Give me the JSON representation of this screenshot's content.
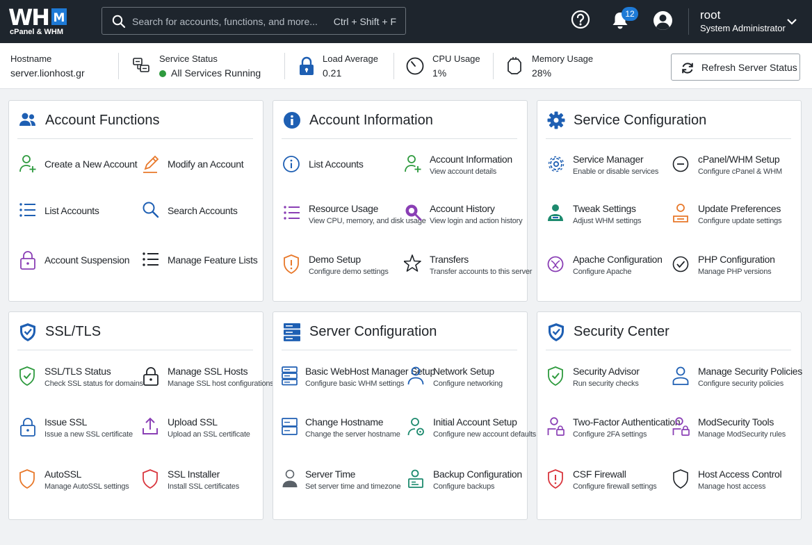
{
  "topbar": {
    "logo_text": "WH",
    "logo_m": "M",
    "logo_sub": "cPanel & WHM",
    "search_placeholder": "Search for accounts, functions, and more...",
    "search_shortcut": "Ctrl + Shift + F",
    "notification_count": "12",
    "user_name": "root",
    "user_role": "System Administrator"
  },
  "status": {
    "hostname_label": "Hostname",
    "hostname_value": "server.lionhost.gr",
    "service_label": "Service Status",
    "service_value": "All Services Running",
    "load_label": "Load Average",
    "load_value": "0.21",
    "cpu_label": "CPU Usage",
    "cpu_value": "1%",
    "memory_label": "Memory Usage",
    "memory_value": "28%",
    "refresh_label": "Refresh Server Status"
  },
  "cards": {
    "account_functions": {
      "title": "Account Functions",
      "items": [
        {
          "title": "Create a New Account"
        },
        {
          "title": "Modify an Account"
        },
        {
          "title": "List Accounts"
        },
        {
          "title": "Search Accounts"
        },
        {
          "title": "Account Suspension"
        },
        {
          "title": "Manage Feature Lists"
        }
      ]
    },
    "account_information": {
      "title": "Account Information",
      "items": [
        {
          "title": "List Accounts",
          "desc": ""
        },
        {
          "title": "Account Information",
          "desc": "View account details"
        },
        {
          "title": "Resource Usage",
          "desc": "View CPU, memory, and disk usage"
        },
        {
          "title": "Account History",
          "desc": "View login and action history"
        },
        {
          "title": "Demo Setup",
          "desc": "Configure demo settings"
        },
        {
          "title": "Transfers",
          "desc": "Transfer accounts to this server"
        }
      ]
    },
    "service_configuration": {
      "title": "Service Configuration",
      "items": [
        {
          "title": "Service Manager",
          "desc": "Enable or disable services"
        },
        {
          "title": "cPanel/WHM Setup",
          "desc": "Configure cPanel & WHM"
        },
        {
          "title": "Tweak Settings",
          "desc": "Adjust WHM settings"
        },
        {
          "title": "Update Preferences",
          "desc": "Configure update settings"
        },
        {
          "title": "Apache Configuration",
          "desc": "Configure Apache"
        },
        {
          "title": "PHP Configuration",
          "desc": "Manage PHP versions"
        }
      ]
    },
    "ssl_tls": {
      "title": "SSL/TLS",
      "items": [
        {
          "title": "SSL/TLS Status",
          "desc": "Check SSL status for domains"
        },
        {
          "title": "Manage SSL Hosts",
          "desc": "Manage SSL host configurations"
        },
        {
          "title": "Issue SSL",
          "desc": "Issue a new SSL certificate"
        },
        {
          "title": "Upload SSL",
          "desc": "Upload an SSL certificate"
        },
        {
          "title": "AutoSSL",
          "desc": "Manage AutoSSL settings"
        },
        {
          "title": "SSL Installer",
          "desc": "Install SSL certificates"
        }
      ]
    },
    "server_configuration": {
      "title": "Server Configuration",
      "items": [
        {
          "title": "Basic WebHost Manager Setup",
          "desc": "Configure basic WHM settings"
        },
        {
          "title": "Network Setup",
          "desc": "Configure networking"
        },
        {
          "title": "Change Hostname",
          "desc": "Change the server hostname"
        },
        {
          "title": "Initial Account Setup",
          "desc": "Configure new account defaults"
        },
        {
          "title": "Server Time",
          "desc": "Set server time and timezone"
        },
        {
          "title": "Backup Configuration",
          "desc": "Configure backups"
        }
      ]
    },
    "security_center": {
      "title": "Security Center",
      "items": [
        {
          "title": "Security Advisor",
          "desc": "Run security checks"
        },
        {
          "title": "Manage Security Policies",
          "desc": "Configure security policies"
        },
        {
          "title": "Two-Factor Authentication",
          "desc": "Configure 2FA settings"
        },
        {
          "title": "ModSecurity Tools",
          "desc": "Manage ModSecurity rules"
        },
        {
          "title": "CSF Firewall",
          "desc": "Configure firewall settings"
        },
        {
          "title": "Host Access Control",
          "desc": "Manage host access"
        }
      ]
    }
  },
  "colors": {
    "topbar_bg": "#1e252d",
    "accent_blue": "#1e7ad6",
    "green": "#2e9a3e",
    "orange": "#e8782a",
    "purple": "#8a3fb5",
    "red": "#d9363e"
  }
}
